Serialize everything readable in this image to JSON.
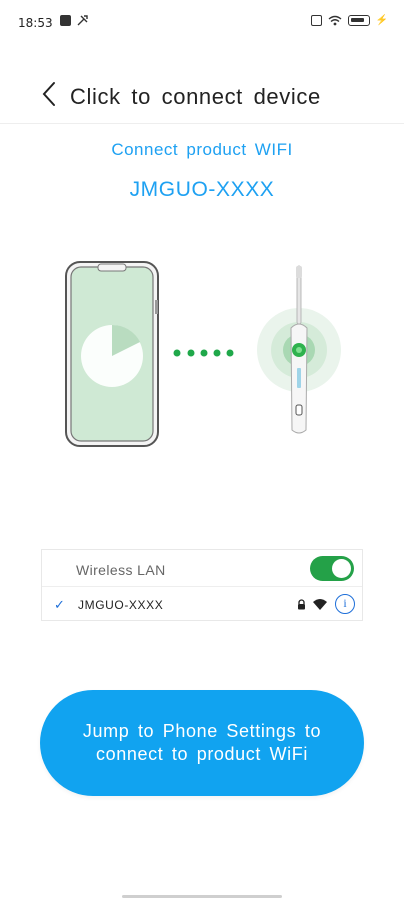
{
  "status_bar": {
    "time": "18:53",
    "left_icons": [
      "notification-app-icon",
      "tools-icon"
    ],
    "right_icons": [
      "sim-icon",
      "wifi-icon",
      "battery-icon",
      "charging-icon"
    ]
  },
  "header": {
    "back_icon": "chevron-left-icon",
    "title": "Click to connect device"
  },
  "connect_label": "Connect product WIFI",
  "ssid": "JMGUO-XXXX",
  "illustration": {
    "phone_icon": "phone-illustration",
    "dots_color": "#1fa84a",
    "device_icon": "toothbrush-device-illustration"
  },
  "wifi_panel": {
    "wlan_label": "Wireless LAN",
    "wlan_enabled": true,
    "network_name": "JMGUO-XXXX",
    "network_connected": true,
    "info_glyph": "i"
  },
  "jump_button": {
    "line1": "Jump to Phone Settings to",
    "line2": "connect to product WiFi"
  },
  "colors": {
    "accent": "#1ea1f2",
    "button": "#11a3f0",
    "toggle_on": "#24a148",
    "check": "#1e6fd9"
  }
}
